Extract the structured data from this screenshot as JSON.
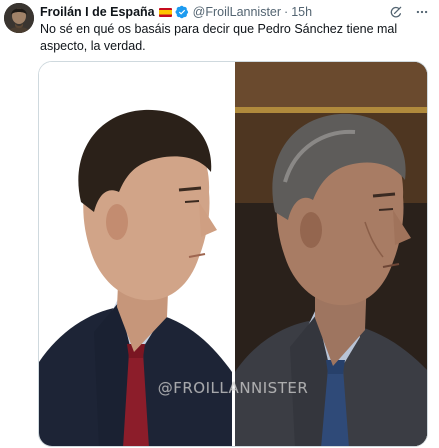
{
  "author": {
    "display_name": "Froilán I de España",
    "handle": "@FroilLannister",
    "separator": "·",
    "time": "15h",
    "flag_icon": "spain-flag-icon",
    "verified_icon": "verified-badge-icon",
    "verified_color": "#1d9bf0"
  },
  "actions": {
    "grok_icon": "grok-icon",
    "more_icon": "more-options-icon"
  },
  "tweet": {
    "text": "No sé en qué os basáis para decir que Pedro Sánchez tiene mal aspecto, la verdad."
  },
  "media": {
    "watermark": "@FROILLANNISTER"
  }
}
